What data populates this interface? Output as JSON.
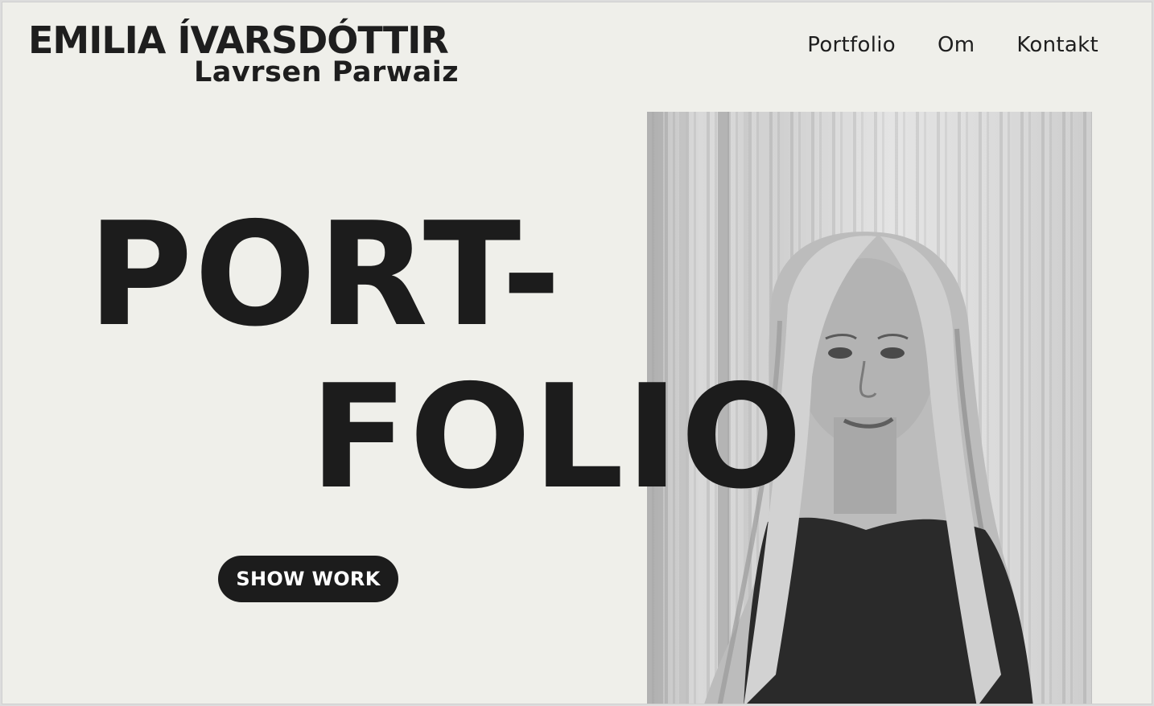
{
  "logo": {
    "line1": "EMILIA ÍVARSDÓTTIR",
    "line2": "Lavrsen Parwaiz"
  },
  "nav": [
    {
      "label": "Portfolio"
    },
    {
      "label": "Om"
    },
    {
      "label": "Kontakt"
    }
  ],
  "hero": {
    "line1": "PORT-",
    "line2": "FOLIO"
  },
  "cta": {
    "label": "SHOW WORK"
  },
  "colors": {
    "background": "#efefea",
    "text": "#1c1c1c",
    "button_bg": "#1c1c1c",
    "button_text": "#ffffff"
  }
}
